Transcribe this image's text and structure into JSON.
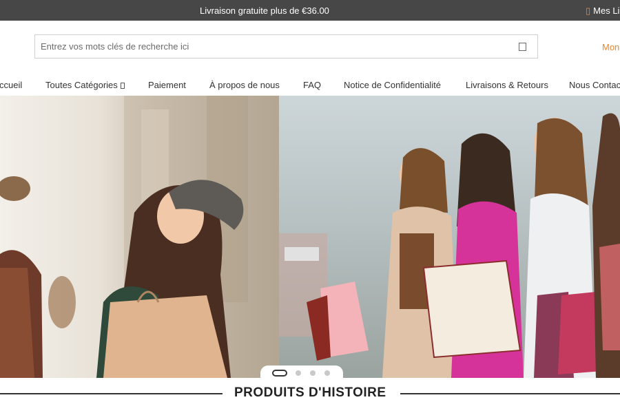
{
  "topbar": {
    "promo": "Livraison gratuite plus de €36.00",
    "my_lists": "Mes Li"
  },
  "search": {
    "placeholder": "Entrez vos mots clés de recherche ici"
  },
  "account": {
    "label": "Mon"
  },
  "nav": {
    "items": [
      {
        "label": "ccueil"
      },
      {
        "label": "Toutes Catégories"
      },
      {
        "label": "Paiement"
      },
      {
        "label": "À propos de nous"
      },
      {
        "label": "FAQ"
      },
      {
        "label": "Notice de Confidentialité"
      },
      {
        "label": "Livraisons & Retours"
      },
      {
        "label": "Nous Contact"
      }
    ]
  },
  "hero": {
    "slides": 4,
    "active_slide": 1
  },
  "section": {
    "title": "PRODUITS D'HISTOIRE"
  },
  "colors": {
    "topbar": "#474747",
    "accent": "#f0862b"
  }
}
